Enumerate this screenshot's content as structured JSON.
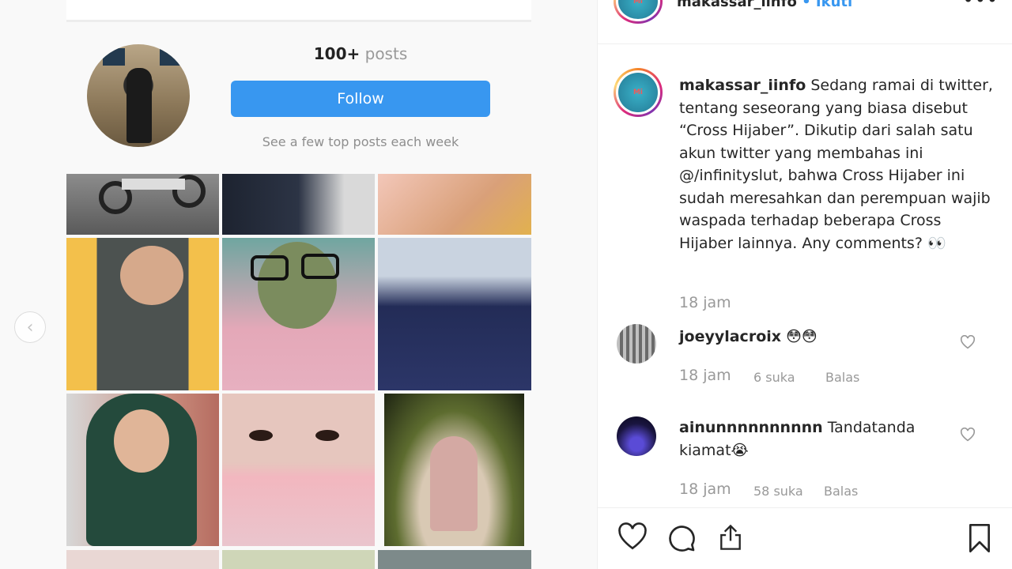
{
  "left": {
    "profile": {
      "posts_count": "100+",
      "posts_label": "posts",
      "follow_label": "Follow",
      "subtitle": "See a few top posts each week"
    }
  },
  "post": {
    "username": "makassar_iinfo",
    "separator": "•",
    "follow_label": "Ikuti",
    "more_label": "•••",
    "caption_text": "Sedang ramai di twitter, tentang seseorang yang biasa disebut “Cross Hijaber”. Dikutip dari salah satu akun twitter yang membahas ini @/infinityslut, bahwa Cross Hijaber ini sudah meresahkan dan perempuan wajib waspada terhadap beberapa Cross Hijaber lainnya. Any comments? 👀",
    "caption_time": "18 jam"
  },
  "comments": [
    {
      "username": "joeyylacroix",
      "text": "😳😳",
      "time": "18 jam",
      "likes": "6 suka",
      "reply": "Balas"
    },
    {
      "username": "ainunnnnnnnnnn",
      "text": "Tandatanda kiamat😭",
      "time": "18 jam",
      "likes": "58 suka",
      "reply": "Balas"
    }
  ],
  "icons": {
    "like": "heart-icon",
    "comment": "comment-icon",
    "share": "share-icon",
    "save": "bookmark-icon",
    "prev": "chevron-left-icon"
  },
  "colors": {
    "accent": "#3897f0",
    "muted": "#999999",
    "text": "#262626"
  }
}
